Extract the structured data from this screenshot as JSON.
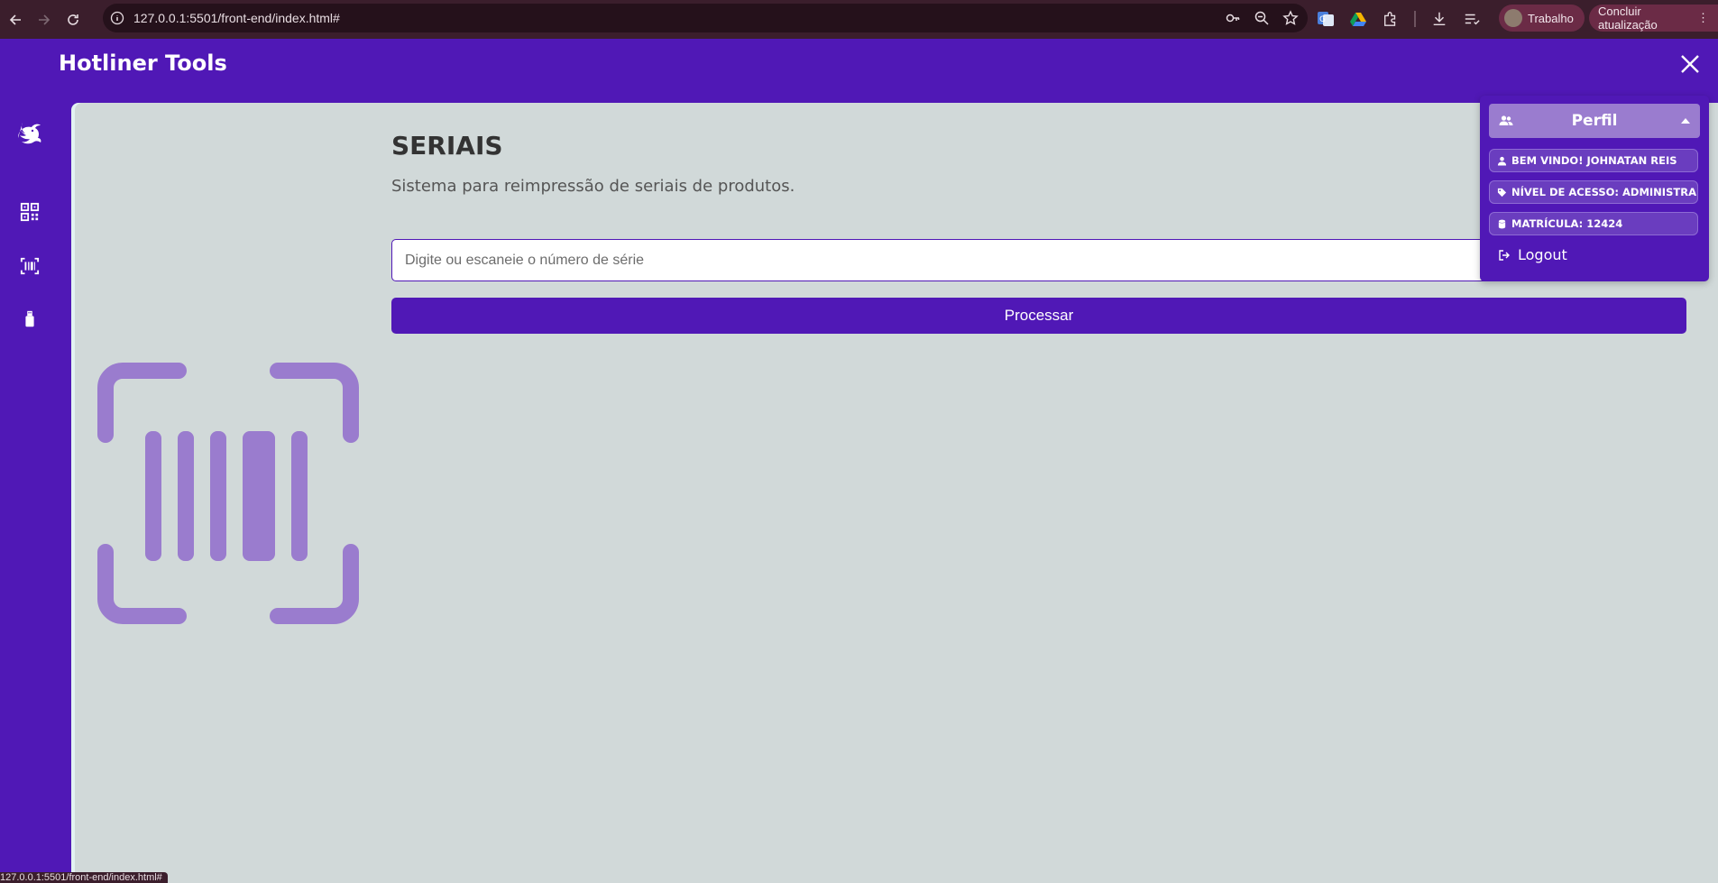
{
  "browser": {
    "url": "127.0.0.1:5501/front-end/index.html#",
    "profile_label": "Trabalho",
    "update_label": "Concluir atualização",
    "status_url": "127.0.0.1:5501/front-end/index.html#"
  },
  "app": {
    "title": "Hotliner Tools"
  },
  "sidebar": {
    "items": [
      {
        "icon": "dragon-logo-icon"
      },
      {
        "icon": "qr-code-icon"
      },
      {
        "icon": "barcode-scan-icon"
      },
      {
        "icon": "usb-icon"
      }
    ]
  },
  "main": {
    "title": "SERIAIS",
    "subtitle": "Sistema para reimpressão de seriais de produtos.",
    "input_placeholder": "Digite ou escaneie o número de série",
    "input_value": "",
    "process_label": "Processar"
  },
  "profile": {
    "header_label": "Perfil",
    "welcome": "BEM VINDO! JOHNATAN REIS",
    "access_level": "NÍVEL DE ACESSO: ADMINISTRADOR",
    "registration": "MATRÍCULA: 12424",
    "logout_label": "Logout"
  },
  "colors": {
    "primary": "#5018b6",
    "panel_bg": "#d1d9d9",
    "illustration": "#9a7cce",
    "chrome_bg": "#3b1e2c"
  }
}
